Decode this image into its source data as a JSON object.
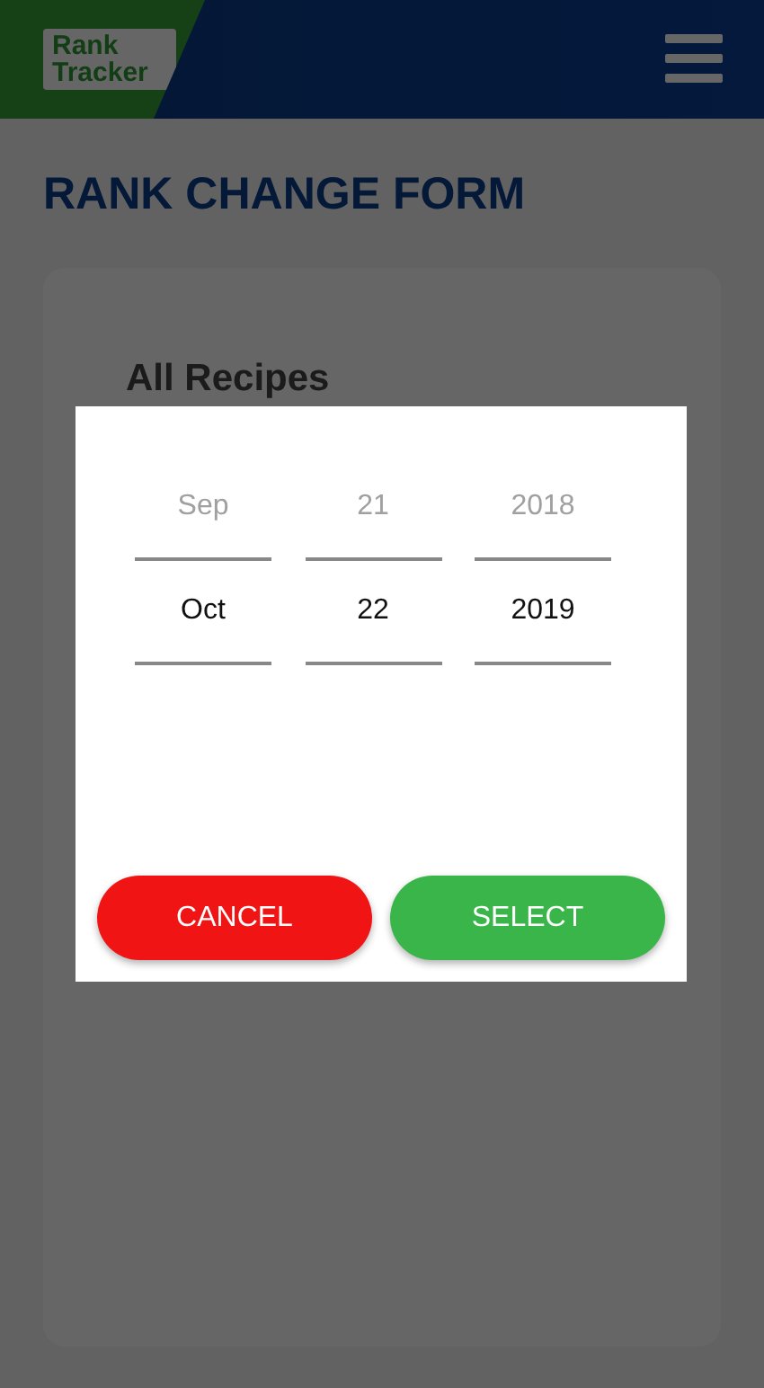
{
  "header": {
    "logo_lines": [
      "Rank",
      "Tracker"
    ]
  },
  "page": {
    "title": "RANK CHANGE FORM",
    "card_heading": "All Recipes"
  },
  "date_picker": {
    "columns": [
      {
        "options": [
          {
            "label": "Sep",
            "selected": false
          },
          {
            "label": "Oct",
            "selected": true
          }
        ]
      },
      {
        "options": [
          {
            "label": "21",
            "selected": false
          },
          {
            "label": "22",
            "selected": true
          }
        ]
      },
      {
        "options": [
          {
            "label": "2018",
            "selected": false
          },
          {
            "label": "2019",
            "selected": true
          }
        ]
      }
    ],
    "buttons": [
      {
        "label": "CANCEL",
        "kind": "cancel"
      },
      {
        "label": "SELECT",
        "kind": "confirm"
      }
    ]
  }
}
